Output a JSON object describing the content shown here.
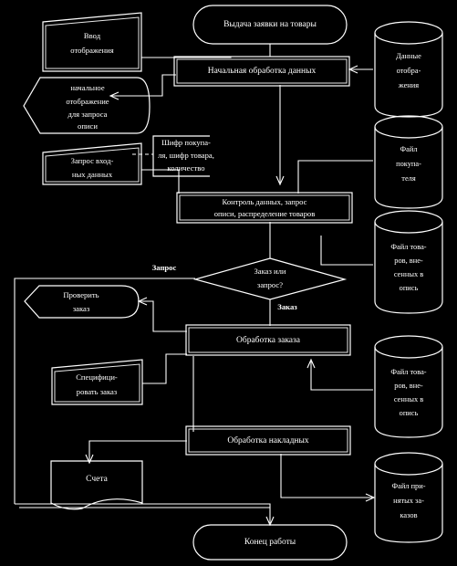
{
  "diagram": {
    "title": "Схема обработки заявок на товары",
    "language": "ru",
    "background_color": "#000000",
    "line_color": "#ffffff"
  },
  "nodes": {
    "start_terminal": {
      "label": "Выдача заявки на товары",
      "shape": "terminator"
    },
    "input_display": {
      "label_line1": "Ввод",
      "label_line2": "отображения",
      "shape": "document"
    },
    "initial_display": {
      "label_line1": "начальное",
      "label_line2": "отображение",
      "label_line3": "для запроса",
      "label_line4": "описи",
      "shape": "display"
    },
    "initial_processing": {
      "label": "Начальная обработка данных",
      "shape": "predefined-process"
    },
    "input_request": {
      "label_line1": "Запрос вход-",
      "label_line2": "ных данных",
      "shape": "document"
    },
    "cipher_note": {
      "label_line1": "Шифр покупа-",
      "label_line2": "ля, шифр товара,",
      "label_line3": "количество",
      "shape": "annotation"
    },
    "data_control": {
      "label_line1": "Контроль данных, запрос",
      "label_line2": "описи, распределение товаров",
      "shape": "predefined-process"
    },
    "decision": {
      "label_line1": "Заказ или",
      "label_line2": "запрос?",
      "shape": "decision"
    },
    "check_order": {
      "label_line1": "Проверить",
      "label_line2": "заказ",
      "shape": "display"
    },
    "order_processing": {
      "label": "Обработка заказа",
      "shape": "predefined-process"
    },
    "specify_order": {
      "label_line1": "Специфици-",
      "label_line2": "ровать заказ",
      "shape": "document"
    },
    "invoice_processing": {
      "label": "Обработка накладных",
      "shape": "predefined-process"
    },
    "invoices": {
      "label": "Счета",
      "shape": "document"
    },
    "end_terminal": {
      "label": "Конец работы",
      "shape": "terminator"
    }
  },
  "databases": [
    {
      "id": "db-display-data",
      "label_line1": "Данные",
      "label_line2": "отобра-",
      "label_line3": "жения"
    },
    {
      "id": "db-buyer-file",
      "label_line1": "Файл",
      "label_line2": "покупа-",
      "label_line3": "теля"
    },
    {
      "id": "db-goods-inventory-1",
      "label_line1": "Файл това-",
      "label_line2": "ров, вне-",
      "label_line3": "сенных в",
      "label_line4": "опись"
    },
    {
      "id": "db-goods-inventory-2",
      "label_line1": "Файл това-",
      "label_line2": "ров, вне-",
      "label_line3": "сенных в",
      "label_line4": "опись"
    },
    {
      "id": "db-accepted-orders",
      "label_line1": "Файл при-",
      "label_line2": "нятых за-",
      "label_line3": "казов"
    }
  ],
  "edge_labels": {
    "branch_query": "Запрос",
    "branch_order": "Заказ"
  }
}
